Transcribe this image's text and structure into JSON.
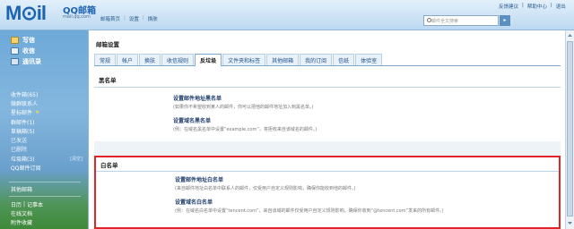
{
  "header": {
    "logo_mark": "M⊙il",
    "logo_text": "QQ邮箱",
    "logo_sub": "mail.qq.com",
    "top_links": [
      "邮箱首页",
      "设置",
      "换肤"
    ],
    "right_links": [
      "反馈建议",
      "帮助中心",
      "退出"
    ],
    "search_placeholder": "邮件全文搜索"
  },
  "sidebar": {
    "tabs": [
      {
        "label": "写信",
        "icon": "pencil-icon"
      },
      {
        "label": "收信",
        "icon": "inbox-icon"
      },
      {
        "label": "通讯录",
        "icon": "contacts-icon"
      }
    ],
    "folders": [
      {
        "label": "收件箱(65)"
      },
      {
        "label": "微群联系人"
      },
      {
        "label": "星标邮件",
        "star": true
      },
      {
        "label": "群邮件(1)"
      },
      {
        "label": "草稿箱(5)"
      },
      {
        "label": "已发送"
      },
      {
        "label": "已删除"
      },
      {
        "label": "垃圾箱(3)",
        "extra": "[清空]"
      },
      {
        "label": "QQ邮件订阅"
      }
    ],
    "other_header": "其他邮箱",
    "bottom_items": [
      "日历",
      "记事本",
      "在线文档",
      "附件收藏"
    ]
  },
  "main": {
    "title": "邮箱设置",
    "tabs": [
      "常规",
      "帐户",
      "换肤",
      "收信规则",
      "反垃圾",
      "文件夹和标签",
      "其他邮箱",
      "我的订阅",
      "信纸",
      "体验室"
    ],
    "active_tab": "反垃圾",
    "blacklist": {
      "heading": "黑名单",
      "options": [
        {
          "title": "设置邮件地址黑名单",
          "desc": "(如果你不希望收到某人的邮件，你可以把他的邮件地址加入到黑名单。)"
        },
        {
          "title": "设置域名黑名单",
          "desc": "(例：在域名黑名单中设置“example.com”，将拒收来自该域名的邮件。)"
        }
      ]
    },
    "whitelist": {
      "heading": "白名单",
      "options": [
        {
          "title": "设置邮件地址白名单",
          "desc": "(来自邮件地址白名单中联系人的邮件，仅受用户自定义规则影响，确保你能收到他的邮件。)"
        },
        {
          "title": "设置域名白名单",
          "desc": "(例：在域名白名单中设置“tencent.com”，来自该域的邮件仅受用户自定义规则影响，确保你收到“@tencent.com”发来的所有邮件。)"
        }
      ]
    }
  },
  "colors": {
    "accent": "#1d64b0",
    "highlight_border": "#e0242a",
    "section_line": "#b9d4ec"
  }
}
